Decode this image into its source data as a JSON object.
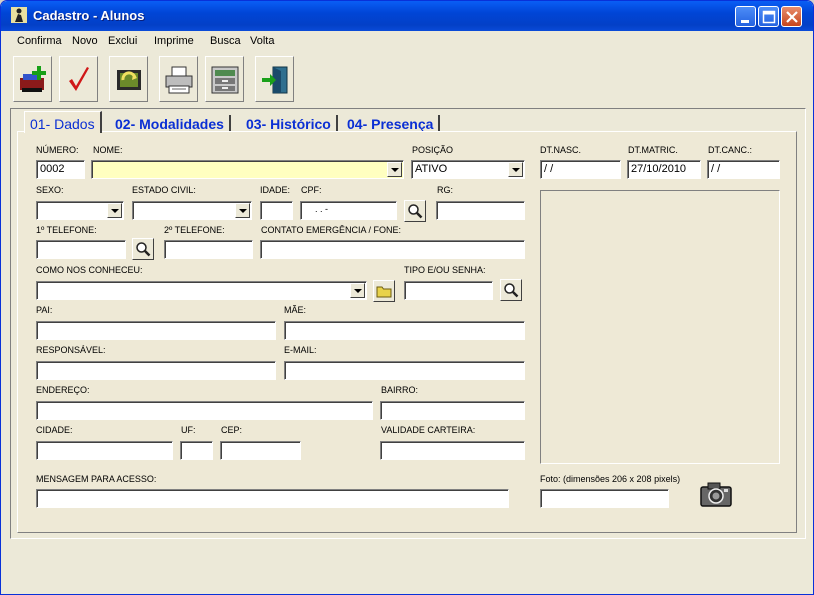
{
  "window": {
    "title": "Cadastro - Alunos"
  },
  "menu": [
    "Confirma",
    "Novo",
    "Exclui",
    "Imprime",
    "Busca",
    "Volta"
  ],
  "toolbar": [
    "add-record-icon",
    "checkmark-icon",
    "refresh-icon",
    "printer-icon",
    "search-file-icon",
    "exit-door-icon"
  ],
  "tabs": [
    "01- Dados",
    "02- Modalidades",
    "03- Histórico",
    "04- Presença"
  ],
  "form": {
    "numero_label": "NÚMERO:",
    "numero_value": "0002",
    "nome_label": "NOME:",
    "nome_value": "",
    "posicao_label": "POSIÇÃO",
    "posicao_value": "ATIVO",
    "sexo_label": "SEXO:",
    "estado_civil_label": "ESTADO CIVIL:",
    "idade_label": "IDADE:",
    "cpf_label": "CPF:",
    "cpf_value": ". . -",
    "rg_label": "RG:",
    "tel1_label": "1º TELEFONE:",
    "tel2_label": "2º TELEFONE:",
    "contato_label": "CONTATO EMERGÊNCIA / FONE:",
    "como_label": "COMO NOS CONHECEU:",
    "tipo_label": "TIPO E/OU SENHA:",
    "pai_label": "PAI:",
    "mae_label": "MÃE:",
    "responsavel_label": "RESPONSÁVEL:",
    "email_label": "E-MAIL:",
    "endereco_label": "ENDEREÇO:",
    "bairro_label": "BAIRRO:",
    "cidade_label": "CIDADE:",
    "uf_label": "UF:",
    "cep_label": "CEP:",
    "validade_label": "VALIDADE CARTEIRA:",
    "mensagem_label": "MENSAGEM PARA ACESSO:",
    "dtnasc_label": "DT.NASC.",
    "dtnasc_value": " / /",
    "dtmatric_label": "DT.MATRIC.",
    "dtmatric_value": "27/10/2010",
    "dtcanc_label": "DT.CANC.:",
    "dtcanc_value": " / /",
    "foto_label": "Foto: (dimensões 206 x 208 pixels)"
  },
  "colors": {
    "title_bar": "#0a5ef5",
    "tab_text": "#0a2fd4",
    "highlight_field": "#ffffc0"
  }
}
